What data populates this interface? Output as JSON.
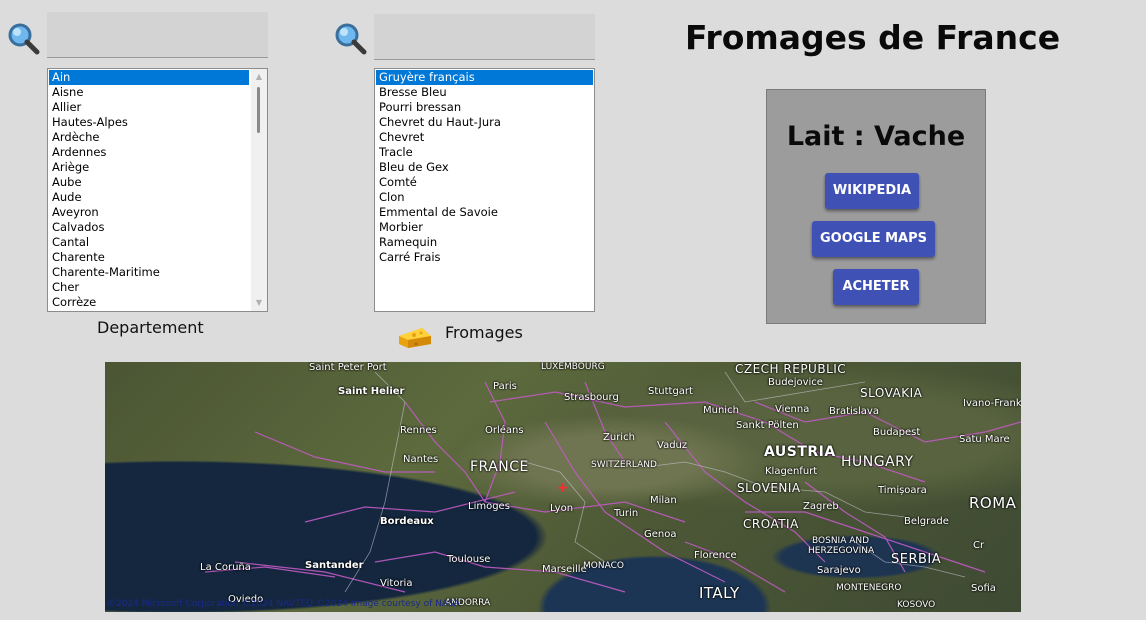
{
  "title": "Fromages de France",
  "departement": {
    "caption": "Departement",
    "items": [
      "Ain",
      "Aisne",
      "Allier",
      "Hautes-Alpes",
      "Ardèche",
      "Ardennes",
      "Ariège",
      "Aube",
      "Aude",
      "Aveyron",
      "Calvados",
      "Cantal",
      "Charente",
      "Charente-Maritime",
      "Cher",
      "Corrèze"
    ],
    "selected": "Ain"
  },
  "fromages": {
    "caption": "Fromages",
    "items": [
      "Gruyère français",
      "Bresse Bleu",
      "Pourri bressan",
      "Chevret du Haut-Jura",
      "Chevret",
      "Tracle",
      "Bleu de Gex",
      "Comté",
      "Clon",
      "Emmental de Savoie",
      "Morbier",
      "Ramequin",
      "Carré Frais"
    ],
    "selected": "Gruyère français"
  },
  "panel": {
    "title": "Lait : Vache",
    "buttons": {
      "wikipedia": "WIKIPEDIA",
      "google_maps": "GOOGLE MAPS",
      "acheter": "ACHETER"
    }
  },
  "map": {
    "countries": {
      "france": "FRANCE",
      "switzerland": "SWITZERLAND",
      "austria": "AUSTRIA",
      "hungary": "HUNGARY",
      "slovenia": "SLOVENIA",
      "croatia": "CROATIA",
      "serbia": "SERBIA",
      "italy": "ITALY",
      "czech": "CZECH REPUBLIC",
      "slovakia": "SLOVAKIA",
      "romania": "ROMA",
      "bosnia": "BOSNIA AND",
      "herzegovina": "HERZEGOVINA",
      "montenegro": "MONTENEGRO",
      "kosovo": "KOSOVO",
      "luxembourg": "LUXEMBOURG",
      "monaco": "MONACO",
      "andorra": "ANDORRA"
    },
    "cities": {
      "saint_peter_port": "Saint Peter Port",
      "saint_helier": "Saint Helier",
      "paris": "Paris",
      "strasbourg": "Strasbourg",
      "stuttgart": "Stuttgart",
      "munich": "Munich",
      "vienna": "Vienna",
      "bratislava": "Bratislava",
      "budejovice": "Budejovice",
      "ivano": "Ivano-Franki",
      "rennes": "Rennes",
      "orleans": "Orléans",
      "zurich": "Zurich",
      "vaduz": "Vaduz",
      "sankt_polten": "Sankt Pölten",
      "budapest": "Budapest",
      "satu_mare": "Satu Mare",
      "nantes": "Nantes",
      "klagenfurt": "Klagenfurt",
      "timisoara": "Timișoara",
      "limoges": "Limoges",
      "lyon": "Lyon",
      "milan": "Milan",
      "bordeaux": "Bordeaux",
      "turin": "Turin",
      "zagreb": "Zagreb",
      "belgrade": "Belgrade",
      "genoa": "Genoa",
      "cluj": "Cr",
      "toulouse": "Toulouse",
      "florence": "Florence",
      "sarajevo": "Sarajevo",
      "la_coruna": "La Coruña",
      "santander": "Santander",
      "marseille": "Marseille",
      "vitoria": "Vitoria",
      "sofia": "Sofia",
      "oviedo": "Oviedo"
    },
    "credit": "©2024 Microsoft Corporation ©2024 NAVTEQ ©2024 Image courtesy of NASA"
  }
}
